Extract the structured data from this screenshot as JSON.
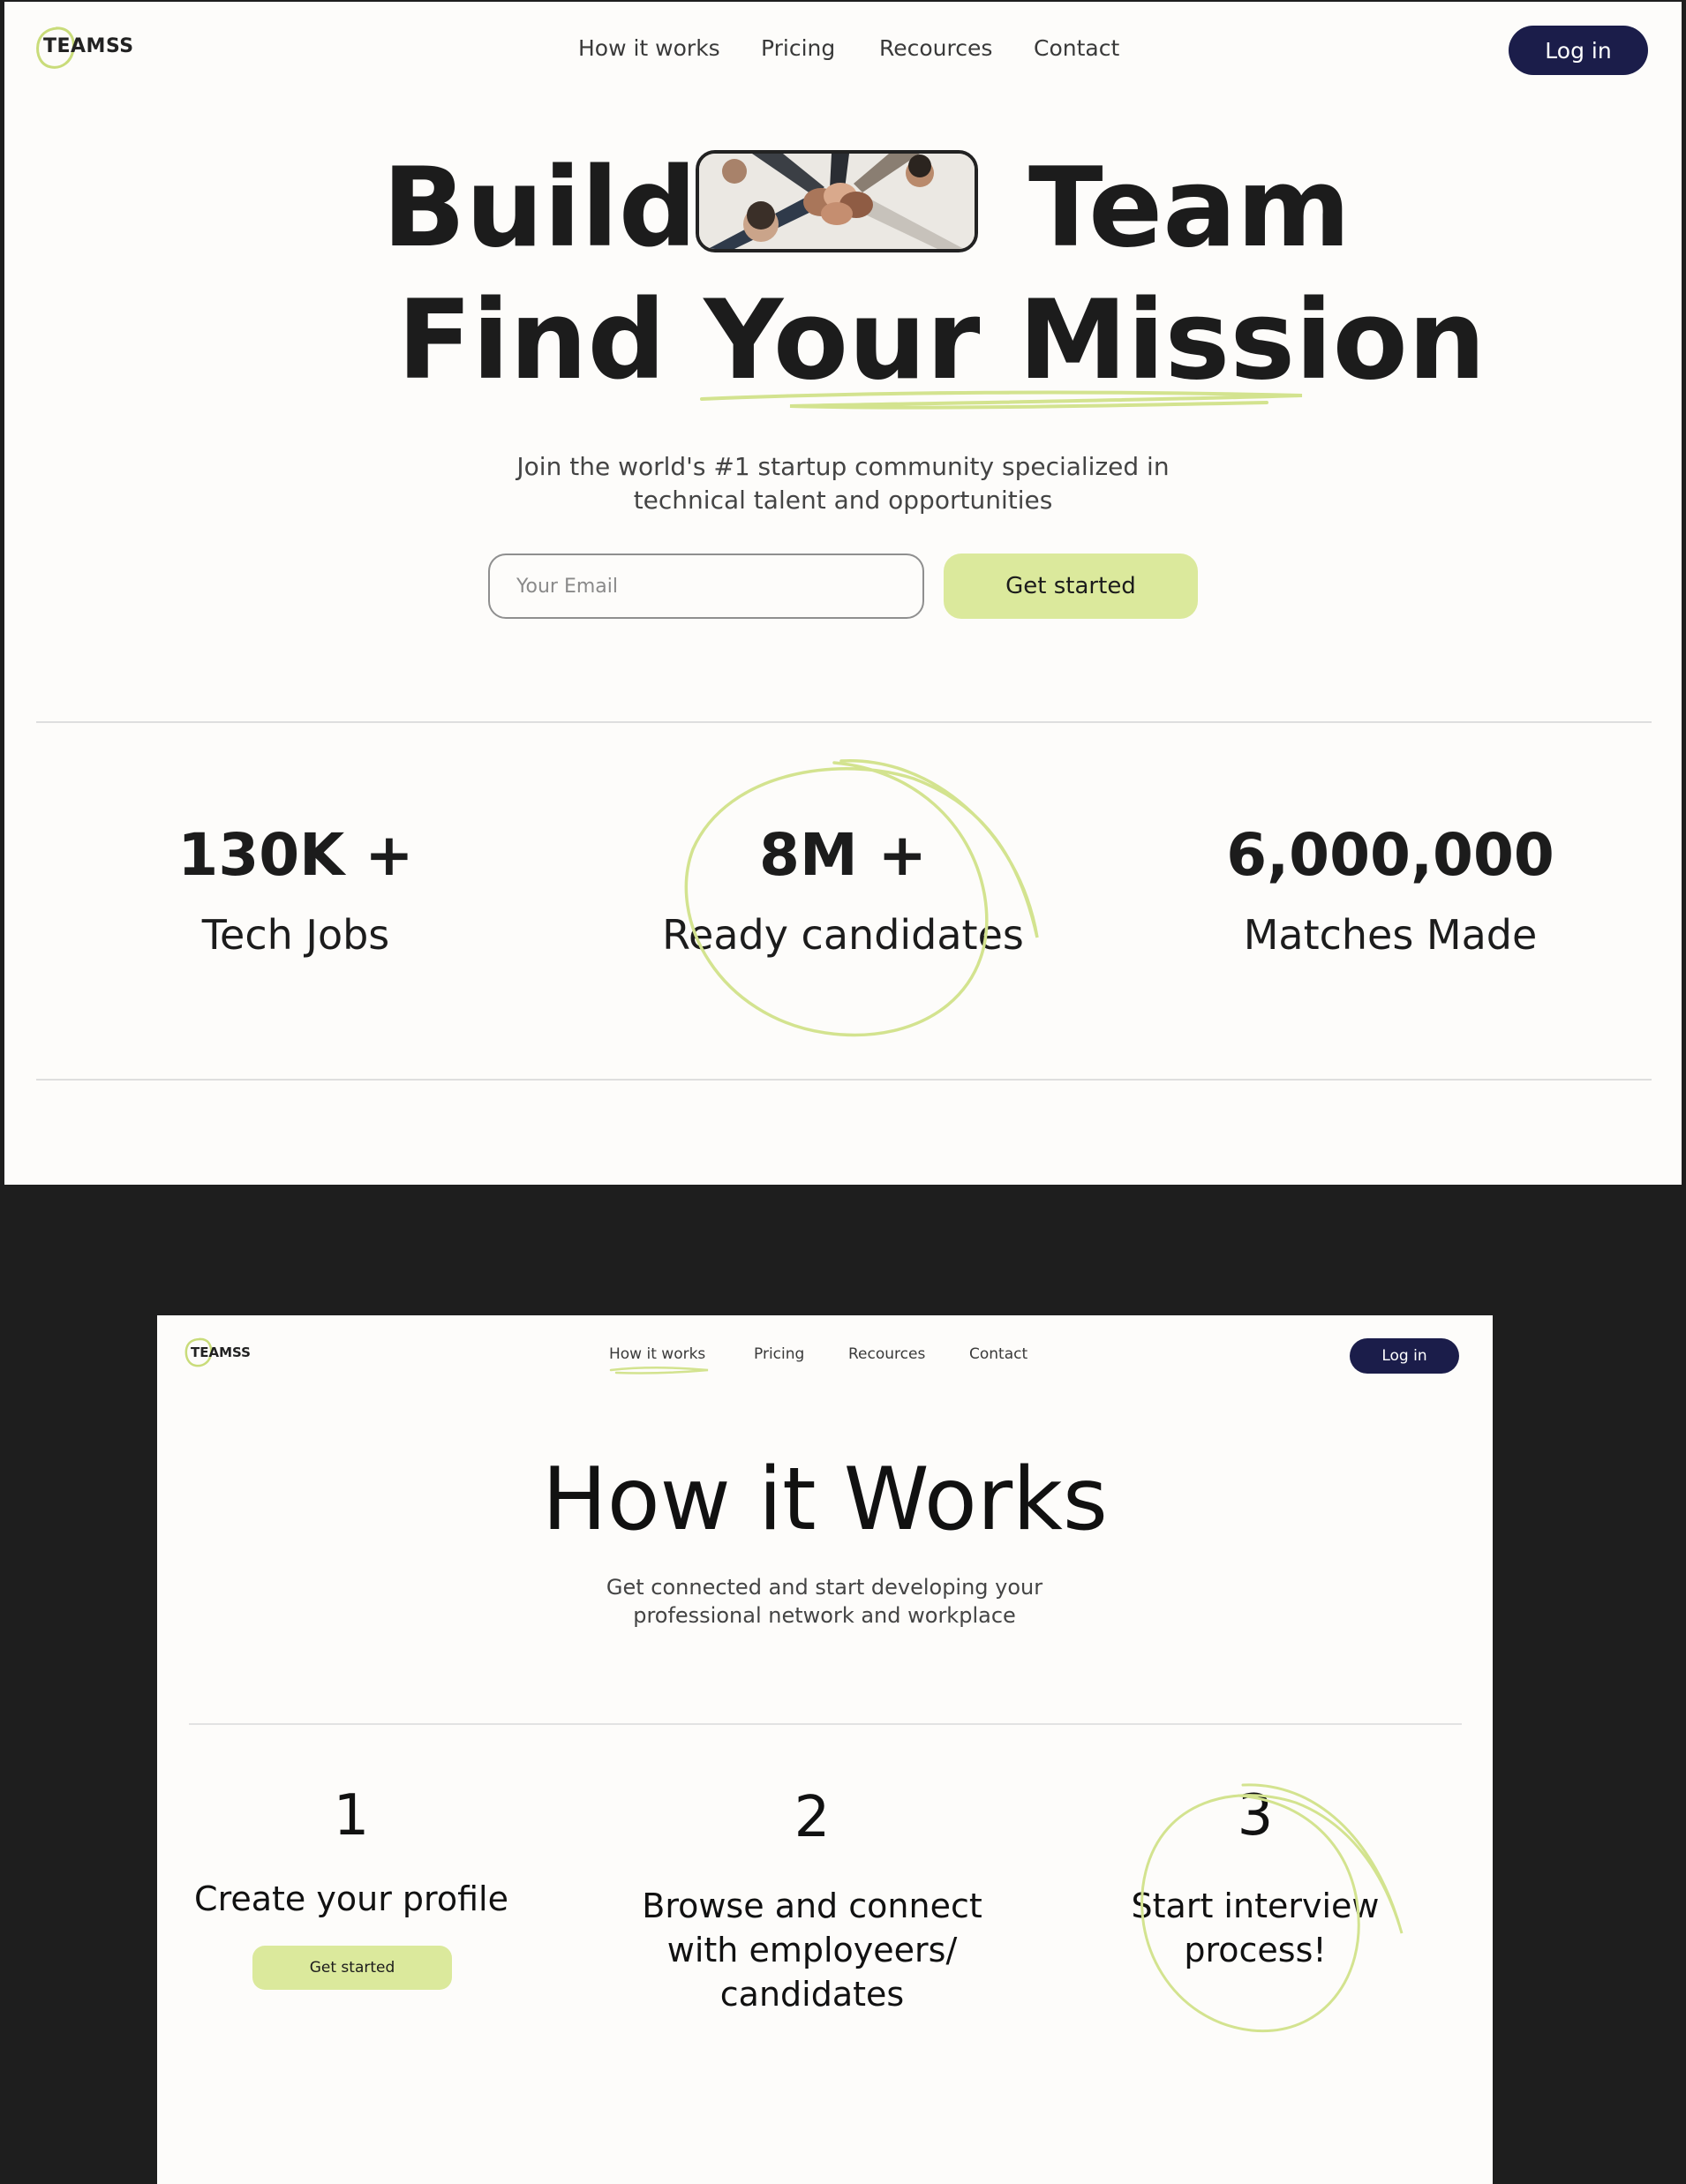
{
  "colors": {
    "accent": "#dbe99c",
    "navy": "#1b1d4a",
    "page_bg": "#fdfcfa",
    "backdrop": "#1e1e1e"
  },
  "frame1": {
    "brand": "TEAMSS",
    "nav": [
      "How it works",
      "Pricing",
      "Recources",
      "Contact"
    ],
    "login_label": "Log in",
    "hero": {
      "line1_left": "Build",
      "line1_right": "Team",
      "line2": "Find Your Mission",
      "photo_icon": "team-fist-bump-photo"
    },
    "subtitle_line1": "Join the world's #1 startup community specialized in",
    "subtitle_line2": "technical talent and opportunities",
    "email_placeholder": "Your Email",
    "cta_label": "Get started",
    "stats": [
      {
        "value": "130K +",
        "label": "Tech Jobs"
      },
      {
        "value": "8M +",
        "label": "Ready candidates"
      },
      {
        "value": "6,000,000",
        "label": "Matches Made"
      }
    ]
  },
  "frame2": {
    "brand": "TEAMSS",
    "nav": [
      "How it works",
      "Pricing",
      "Recources",
      "Contact"
    ],
    "active_nav": "How it works",
    "login_label": "Log in",
    "title": "How it Works",
    "subtitle_line1": "Get connected and start developing your",
    "subtitle_line2": "professional network and workplace",
    "steps": [
      {
        "number": "1",
        "lines": [
          "Create your profile"
        ],
        "button": "Get started"
      },
      {
        "number": "2",
        "lines": [
          "Browse and connect",
          "with employeers/",
          "candidates"
        ]
      },
      {
        "number": "3",
        "lines": [
          "Start interview",
          "process!"
        ]
      }
    ]
  }
}
